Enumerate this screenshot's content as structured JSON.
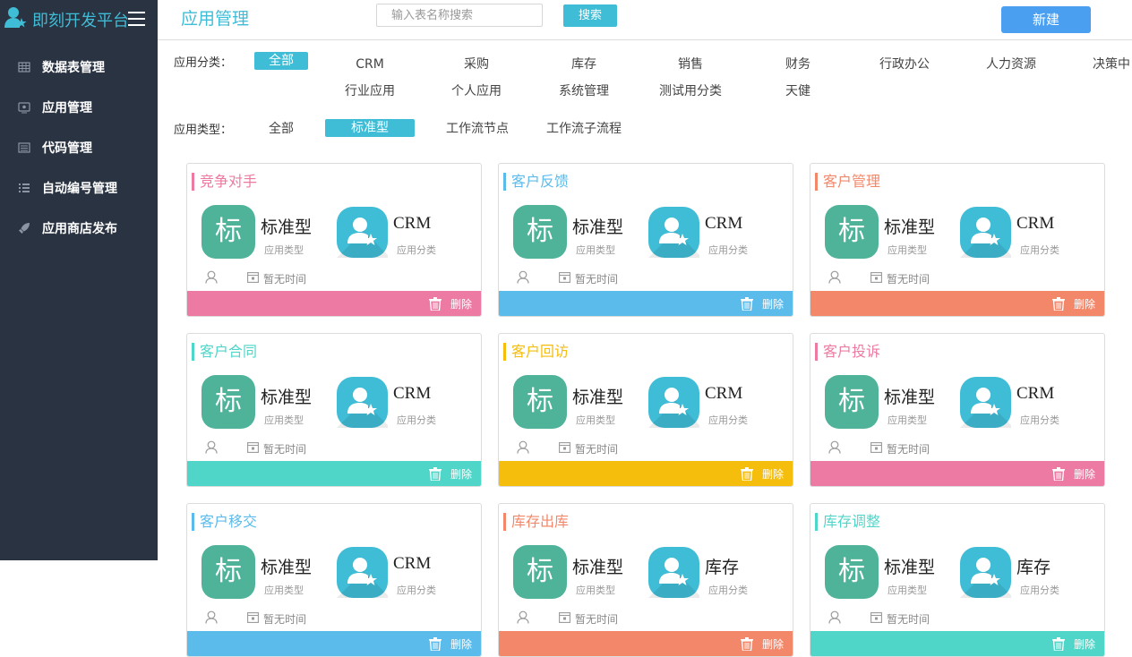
{
  "brand": {
    "title": "即刻开发平台",
    "logo_icon": "user-star-icon",
    "menu_icon": "hamburger-icon"
  },
  "sidebar": {
    "items": [
      {
        "label": "数据表管理",
        "icon": "table-grid-icon"
      },
      {
        "label": "应用管理",
        "icon": "monitor-icon"
      },
      {
        "label": "代码管理",
        "icon": "list-window-icon"
      },
      {
        "label": "自动编号管理",
        "icon": "bullet-list-icon"
      },
      {
        "label": "应用商店发布",
        "icon": "rocket-icon"
      }
    ]
  },
  "header": {
    "title": "应用管理",
    "search_placeholder": "输入表名称搜索",
    "search_value": "",
    "search_label": "搜索",
    "new_label": "新建"
  },
  "filters": {
    "category_label": "应用分类：",
    "categories_row1": [
      "全部",
      "CRM",
      "采购",
      "库存",
      "销售",
      "财务",
      "行政办公",
      "人力资源",
      "决策中"
    ],
    "categories_row2": [
      "行业应用",
      "个人应用",
      "系统管理",
      "测试用分类",
      "天健"
    ],
    "category_active": "全部",
    "type_label": "应用类型：",
    "types": [
      "全部",
      "标准型",
      "工作流节点",
      "工作流子流程"
    ],
    "type_active": "标准型"
  },
  "colors": {
    "accent": "#3fbcd6",
    "sidebar_bg": "#2a3342",
    "new_button": "#4a9ff0",
    "tag_green": "#4fb39a"
  },
  "cards": [
    {
      "title": "竞争对手",
      "color": "#ec7aa3",
      "type_char": "标",
      "type": "标准型",
      "type_sub": "应用类型",
      "category": "CRM",
      "category_sub": "应用分类",
      "time": "暂无时间",
      "delete_label": "删除"
    },
    {
      "title": "客户反馈",
      "color": "#5bbcec",
      "type_char": "标",
      "type": "标准型",
      "type_sub": "应用类型",
      "category": "CRM",
      "category_sub": "应用分类",
      "time": "暂无时间",
      "delete_label": "删除"
    },
    {
      "title": "客户管理",
      "color": "#f3876a",
      "type_char": "标",
      "type": "标准型",
      "type_sub": "应用类型",
      "category": "CRM",
      "category_sub": "应用分类",
      "time": "暂无时间",
      "delete_label": "删除"
    },
    {
      "title": "客户合同",
      "color": "#4fd6c9",
      "type_char": "标",
      "type": "标准型",
      "type_sub": "应用类型",
      "category": "CRM",
      "category_sub": "应用分类",
      "time": "暂无时间",
      "delete_label": "删除"
    },
    {
      "title": "客户回访",
      "color": "#f5bd0c",
      "type_char": "标",
      "type": "标准型",
      "type_sub": "应用类型",
      "category": "CRM",
      "category_sub": "应用分类",
      "time": "暂无时间",
      "delete_label": "删除"
    },
    {
      "title": "客户投诉",
      "color": "#ec7aa3",
      "type_char": "标",
      "type": "标准型",
      "type_sub": "应用类型",
      "category": "CRM",
      "category_sub": "应用分类",
      "time": "暂无时间",
      "delete_label": "删除"
    },
    {
      "title": "客户移交",
      "color": "#5bbcec",
      "type_char": "标",
      "type": "标准型",
      "type_sub": "应用类型",
      "category": "CRM",
      "category_sub": "应用分类",
      "time": "暂无时间",
      "delete_label": "删除"
    },
    {
      "title": "库存出库",
      "color": "#f3876a",
      "type_char": "标",
      "type": "标准型",
      "type_sub": "应用类型",
      "category": "库存",
      "category_sub": "应用分类",
      "time": "暂无时间",
      "delete_label": "删除"
    },
    {
      "title": "库存调整",
      "color": "#4fd6c9",
      "type_char": "标",
      "type": "标准型",
      "type_sub": "应用类型",
      "category": "库存",
      "category_sub": "应用分类",
      "time": "暂无时间",
      "delete_label": "删除"
    }
  ]
}
